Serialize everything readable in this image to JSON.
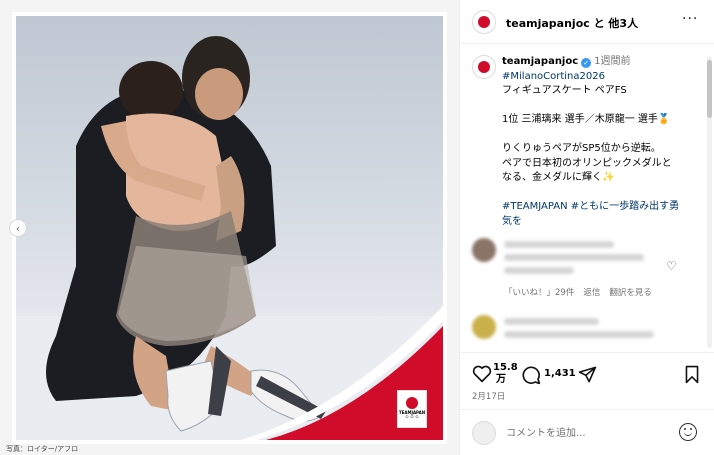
{
  "photo": {
    "credit": "写真：ロイター/アフロ",
    "logo_text": "TEAMJAPAN",
    "logo_rings": "⚪⚪⚪",
    "accent_color": "#d10b2a"
  },
  "header": {
    "author_line": "teamjapanjoc と 他3人",
    "more_icon": "···"
  },
  "caption": {
    "username": "teamjapanjoc",
    "verified_icon": "✓",
    "time": "1週間前",
    "hashtag_event": "#MilanoCortina2026",
    "line_event": "フィギュアスケート ペアFS",
    "line_result": "1位 三浦璃来 選手／木原龍一 選手🏅",
    "line_story_1": "りくりゅうペアがSP5位から逆転。",
    "line_story_2": "ペアで日本初のオリンピックメダルと",
    "line_story_3": "なる、金メダルに輝く✨",
    "hashtags_line_1": "#TEAMJAPAN  #ともに一歩踏み出す勇",
    "hashtags_line_2": "気を"
  },
  "comment_meta": {
    "likes": "「いいね！」29件",
    "reply": "返信",
    "translate": "翻訳を見る"
  },
  "actions": {
    "like_count": "15.8万",
    "like_count_top": "15.8",
    "like_count_bottom": "万",
    "comment_count": "1,431",
    "date": "2月17日"
  },
  "add_comment": {
    "placeholder": "コメントを追加..."
  },
  "icons": {
    "like": "heart-icon",
    "comment": "comment-bubble-icon",
    "share": "paper-plane-icon",
    "save": "bookmark-icon",
    "emoji": "smiley-icon",
    "prev": "chevron-left-icon"
  }
}
